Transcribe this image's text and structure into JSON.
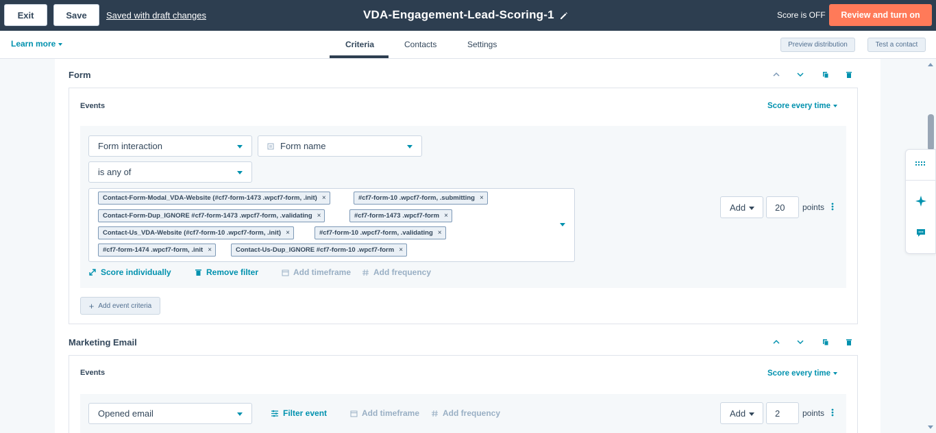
{
  "header": {
    "exit_label": "Exit",
    "save_label": "Save",
    "draft_status": "Saved with draft changes",
    "title": "VDA-Engagement-Lead-Scoring-1",
    "score_status": "Score is OFF",
    "review_label": "Review and turn on"
  },
  "subnav": {
    "learn_more": "Learn more",
    "tabs": [
      {
        "label": "Criteria",
        "active": true
      },
      {
        "label": "Contacts",
        "active": false
      },
      {
        "label": "Settings",
        "active": false
      }
    ],
    "preview_label": "Preview distribution",
    "test_label": "Test a contact"
  },
  "form_section": {
    "title": "Form",
    "events_label": "Events",
    "score_every": "Score every time",
    "event_type": "Form interaction",
    "property": "Form name",
    "operator": "is any of",
    "values": [
      "Contact-Form-Modal_VDA-Website (#cf7-form-1473 .wpcf7-form, .init)",
      "#cf7-form-10 .wpcf7-form, .submitting",
      "Contact-Form-Dup_IGNORE #cf7-form-1473 .wpcf7-form, .validating",
      "#cf7-form-1473 .wpcf7-form",
      "Contact-Us_VDA-Website (#cf7-form-10 .wpcf7-form, .init)",
      "#cf7-form-10 .wpcf7-form, .validating",
      "#cf7-form-1474 .wpcf7-form, .init",
      "Contact-Us-Dup_IGNORE #cf7-form-10 .wpcf7-form"
    ],
    "score_individually": "Score individually",
    "remove_filter": "Remove filter",
    "add_timeframe": "Add timeframe",
    "add_frequency": "Add frequency",
    "add_label": "Add",
    "points_value": "20",
    "points_label": "points",
    "add_event_criteria": "Add event criteria"
  },
  "email_section": {
    "title": "Marketing Email",
    "events_label": "Events",
    "score_every": "Score every time",
    "event_type": "Opened email",
    "filter_event": "Filter event",
    "add_timeframe": "Add timeframe",
    "add_frequency": "Add frequency",
    "add_label": "Add",
    "points_value": "2",
    "points_label": "points"
  },
  "icons": {
    "edit": "pencil-icon",
    "move_up": "chevron-up-icon",
    "move_down": "chevron-down-icon",
    "clone": "copy-icon",
    "delete": "trash-icon",
    "more": "kebab-menu-icon",
    "side_tools": [
      "grid-icon",
      "sparkle-icon",
      "chat-icon"
    ]
  },
  "colors": {
    "header_bg": "#2d3e50",
    "accent": "#0091ae",
    "primary_button": "#ff7a59"
  }
}
